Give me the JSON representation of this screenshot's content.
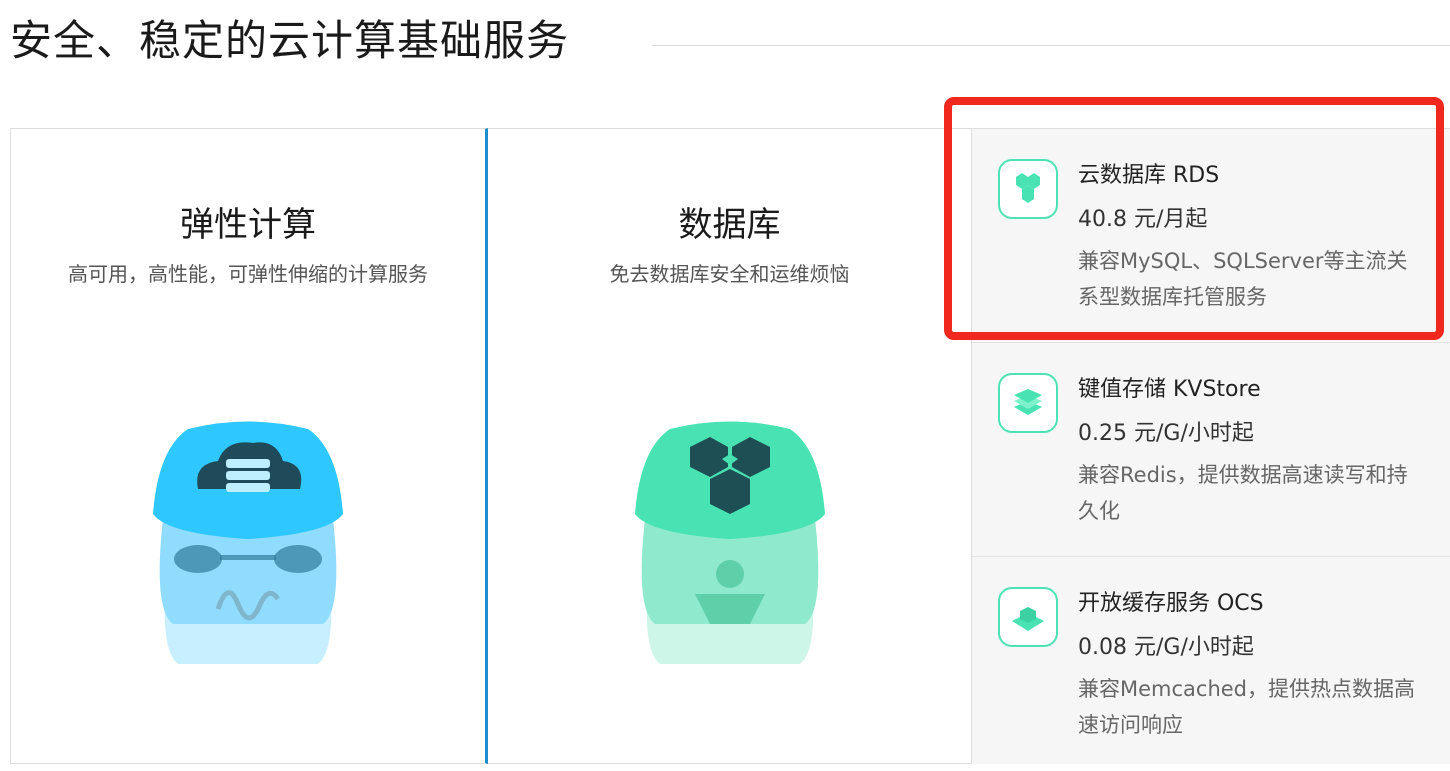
{
  "section": {
    "title": "安全、稳定的云计算基础服务"
  },
  "panels": [
    {
      "heading": "弹性计算",
      "subtitle": "高可用，高性能，可弹性伸缩的计算服务"
    },
    {
      "heading": "数据库",
      "subtitle": "免去数据库安全和运维烦恼"
    }
  ],
  "products": [
    {
      "name": "云数据库 RDS",
      "price": "40.8 元/月起",
      "desc": "兼容MySQL、SQLServer等主流关系型数据库托管服务",
      "icon": "hexagons-icon"
    },
    {
      "name": "键值存储 KVStore",
      "price": "0.25 元/G/小时起",
      "desc": "兼容Redis，提供数据高速读写和持久化",
      "icon": "layers-icon"
    },
    {
      "name": "开放缓存服务 OCS",
      "price": "0.08 元/G/小时起",
      "desc": "兼容Memcached，提供热点数据高速访问响应",
      "icon": "cube-stack-icon"
    }
  ],
  "colors": {
    "accent_blue": "#1d8ecb",
    "mint": "#4de2b4",
    "highlight_red": "#f0281e",
    "sky": "#2ec7ff"
  }
}
